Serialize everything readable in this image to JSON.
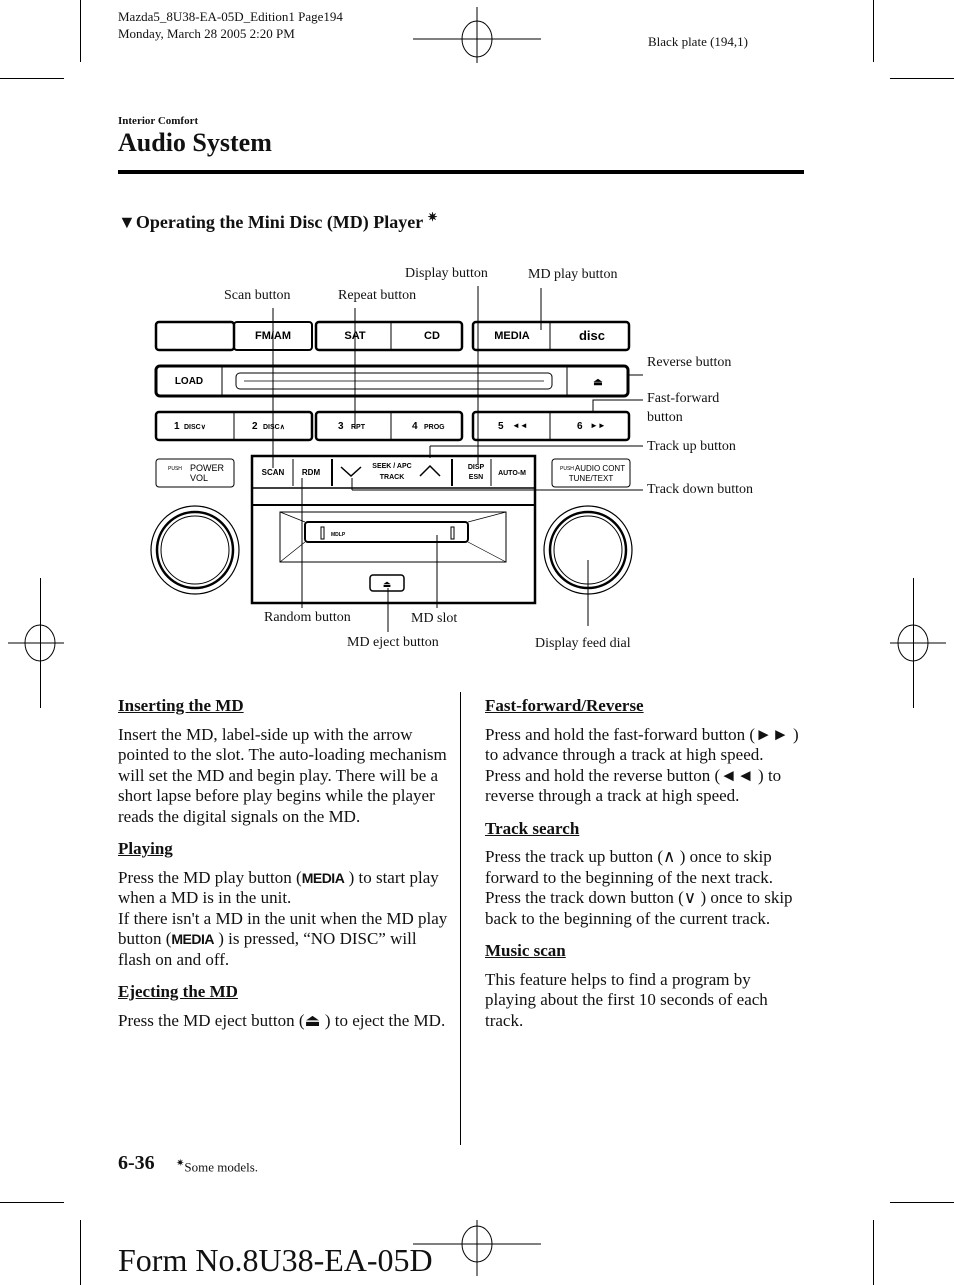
{
  "print_header": {
    "file_line": "Mazda5_8U38-EA-05D_Edition1 Page194",
    "date_line": "Monday, March 28 2005 2:20 PM",
    "plate": "Black plate (194,1)"
  },
  "section": "Interior Comfort",
  "page_title": "Audio System",
  "subsection": {
    "marker": "▼",
    "title": "Operating the Mini Disc (MD) Player",
    "star": "✷"
  },
  "diagram": {
    "callouts": {
      "scan": "Scan button",
      "repeat": "Repeat button",
      "display": "Display button",
      "md_play": "MD play button",
      "reverse": "Reverse button",
      "fast_forward_1": "Fast-forward",
      "fast_forward_2": "button",
      "track_up": "Track up button",
      "track_down": "Track down button",
      "random": "Random button",
      "md_slot": "MD slot",
      "md_eject": "MD eject button",
      "display_feed": "Display feed dial"
    },
    "buttons": {
      "fm_am": "FM/AM",
      "sat": "SAT",
      "cd": "CD",
      "media": "MEDIA",
      "compact_disc": "disc",
      "load": "LOAD",
      "eject": "⏏",
      "p1": "1",
      "p1_sub": "DISC∨",
      "p2": "2",
      "p2_sub": "DISC∧",
      "p3": "3",
      "p3_sub": "RPT",
      "p4": "4",
      "p4_sub": "PROG",
      "p5": "5",
      "p5_sub": "◄◄",
      "p6": "6",
      "p6_sub": "►►",
      "power_push": "PUSH",
      "power": "POWER",
      "vol": "VOL",
      "scan": "SCAN",
      "rdm": "RDM",
      "seek_apc": "SEEK / APC",
      "track": "TRACK",
      "disp": "DISP",
      "esn": "ESN",
      "auto_m": "AUTO-M",
      "audio_push": "PUSH",
      "audio_cont": "AUDIO CONT",
      "tune_text": "TUNE/TEXT",
      "mdlp": "MDLP",
      "md_eject": "⏏"
    }
  },
  "left_column": [
    {
      "heading": "Inserting the MD",
      "paragraphs": [
        "Insert the MD, label-side up with the arrow pointed to the slot. The auto-loading mechanism will set the MD and begin play. There will be a short lapse before play begins while the player reads the digital signals on the MD."
      ]
    },
    {
      "heading": "Playing",
      "p1a": "Press the MD play button (",
      "p1_icon": "MEDIA",
      "p1b": " ) to start play when a MD is in the unit.",
      "p2a": "If there isn't a MD in the unit when the MD play button (",
      "p2_icon": "MEDIA",
      "p2b": " ) is pressed, “NO DISC” will flash on and off."
    },
    {
      "heading": "Ejecting the MD",
      "pa": "Press the MD eject button (",
      "p_icon": "⏏",
      "pb": " ) to eject the MD."
    }
  ],
  "right_column": [
    {
      "heading": "Fast-forward/Reverse",
      "p1a": "Press and hold the fast-forward button (",
      "p1_icon": "►►",
      "p1b": " ) to advance through a track at high speed.",
      "p2a": "Press and hold the reverse button (",
      "p2_icon": "◄◄",
      "p2b": " ) to reverse through a track at high speed."
    },
    {
      "heading": "Track search",
      "p1a": "Press the track up button (",
      "p1_icon": "∧",
      "p1b": " ) once to skip forward to the beginning of the next track.",
      "p2a": "Press the track down button (",
      "p2_icon": "∨",
      "p2b": " ) once to skip back to the beginning of the current track."
    },
    {
      "heading": "Music scan",
      "paragraphs": [
        "This feature helps to find a program by playing about the first 10 seconds of each track."
      ]
    }
  ],
  "footer": {
    "page_number": "6-36",
    "note_star": "✷",
    "note": "Some models.",
    "form_number": "Form No.8U38-EA-05D"
  }
}
